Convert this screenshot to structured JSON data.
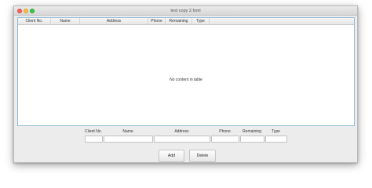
{
  "window": {
    "title": "test copy 2.fxml"
  },
  "table": {
    "columns": [
      "Client No.",
      "Name",
      "Address",
      "Phone",
      "Remaining",
      "Type"
    ],
    "placeholder": "No content in table"
  },
  "form": {
    "labels": [
      "Client No.",
      "Name",
      "Address",
      "Phone",
      "Remaining",
      "Type"
    ],
    "values": [
      "",
      "",
      "",
      "",
      "",
      ""
    ]
  },
  "buttons": {
    "add": "Add",
    "delete": "Delete"
  }
}
